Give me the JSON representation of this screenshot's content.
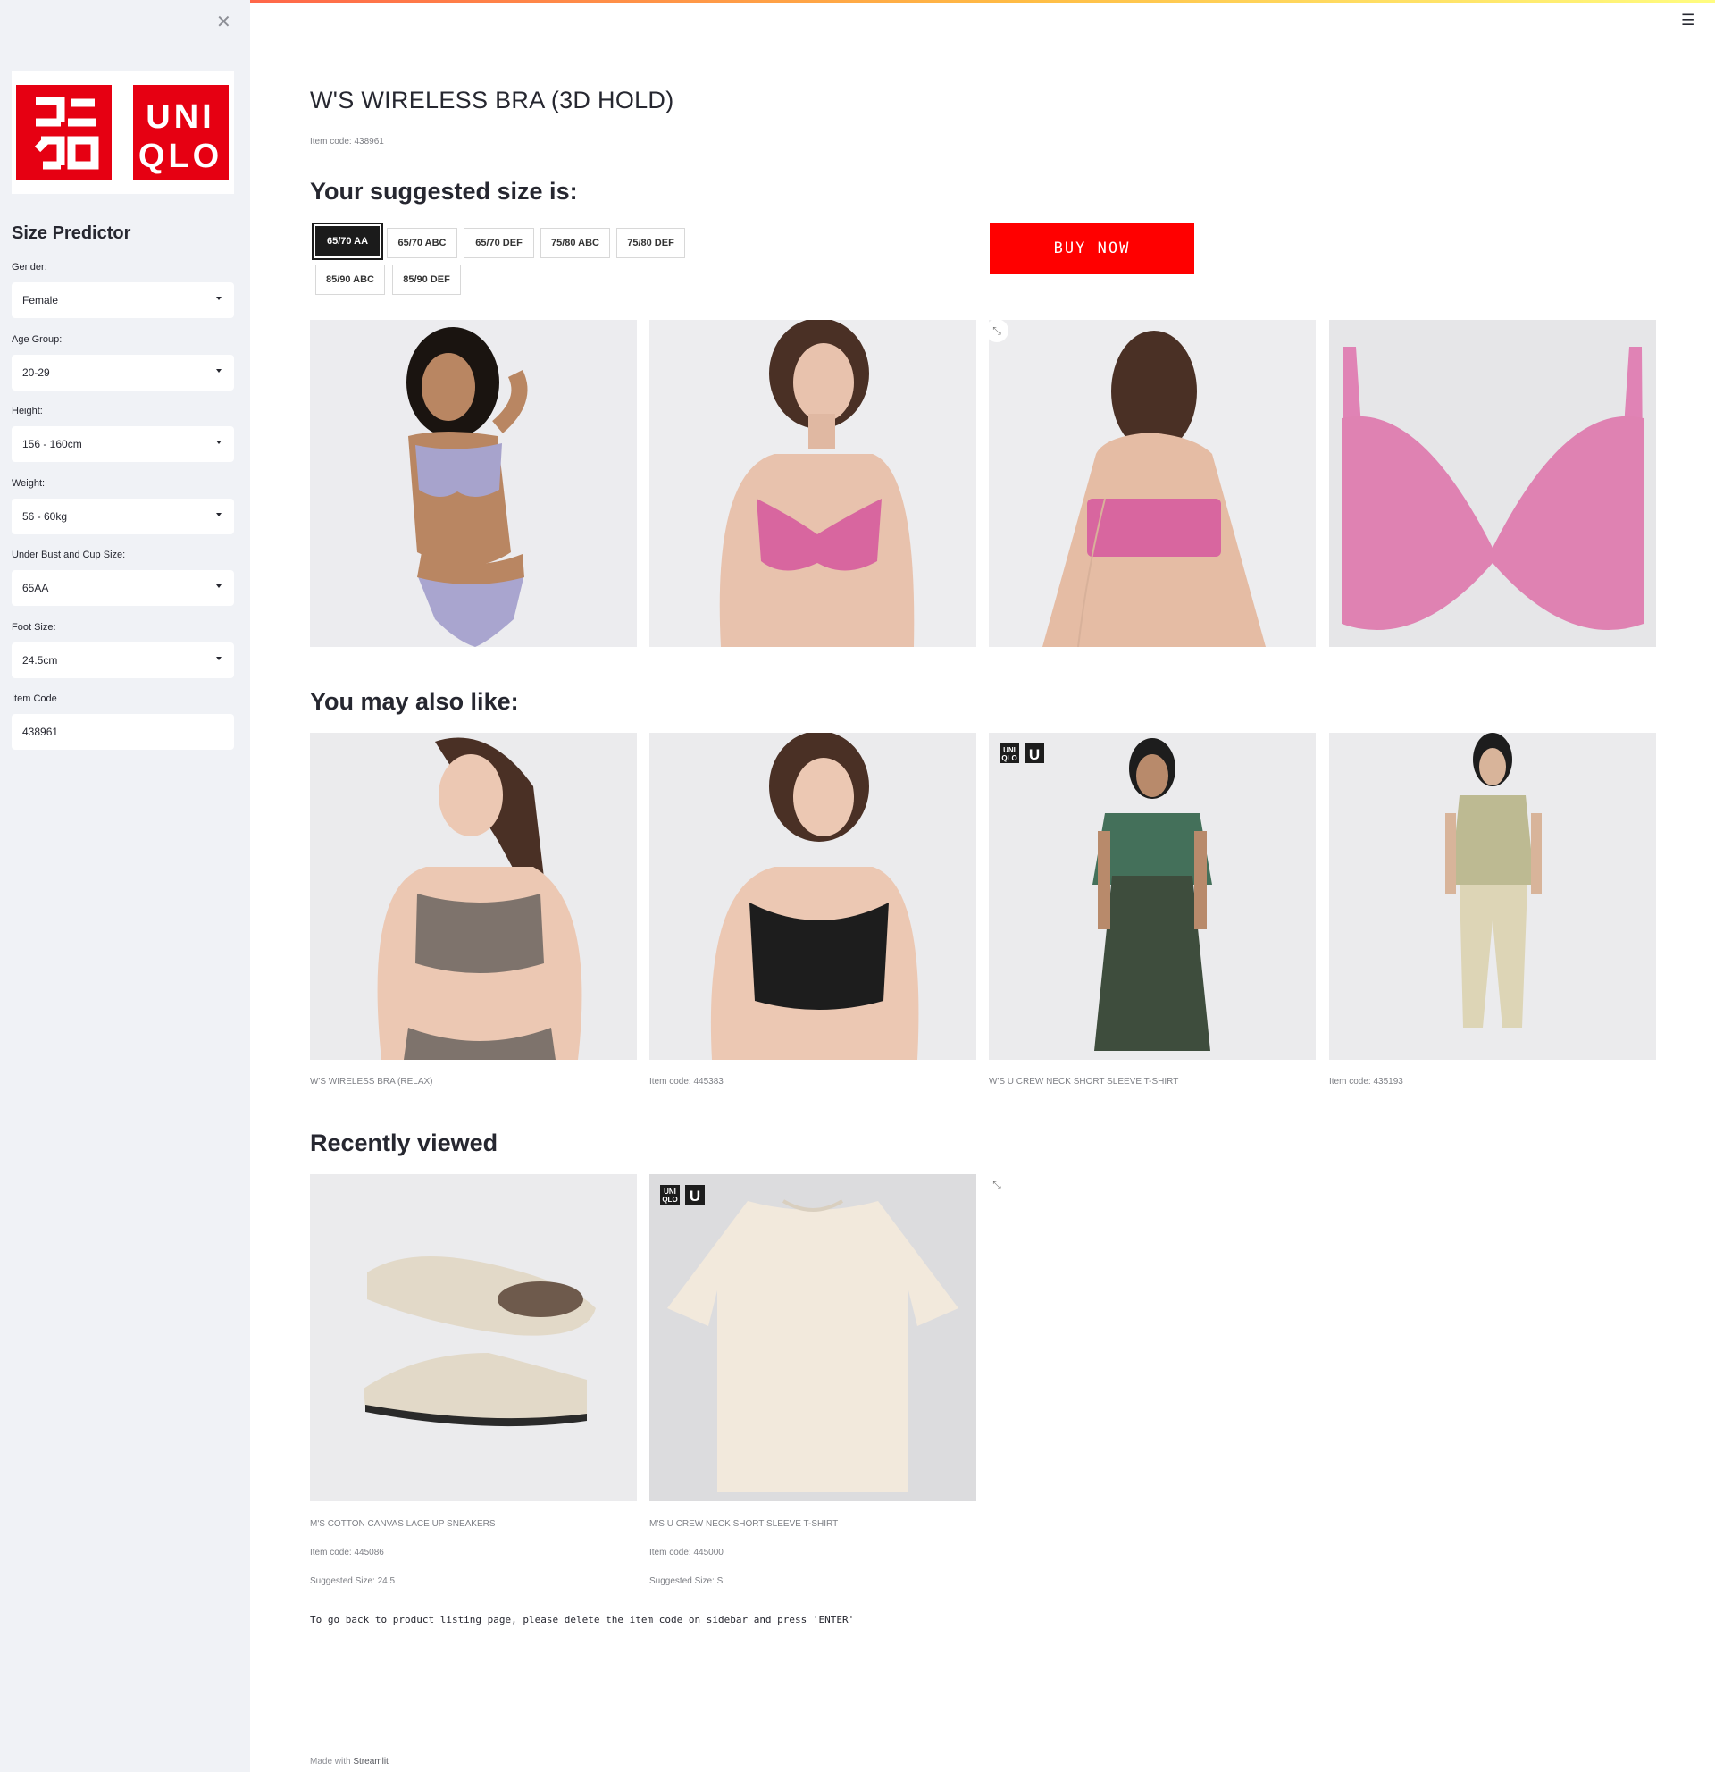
{
  "sidebar": {
    "logo": {
      "left_text": "ユニクロ",
      "right_text": "UNIQLO",
      "color": "#e60012"
    },
    "title": "Size Predictor",
    "fields": [
      {
        "label": "Gender:",
        "value": "Female"
      },
      {
        "label": "Age Group:",
        "value": "20-29"
      },
      {
        "label": "Height:",
        "value": "156 - 160cm"
      },
      {
        "label": "Weight:",
        "value": "56 - 60kg"
      },
      {
        "label": "Under Bust and Cup Size:",
        "value": "65AA"
      },
      {
        "label": "Foot Size:",
        "value": "24.5cm"
      }
    ],
    "item_code": {
      "label": "Item Code",
      "value": "438961"
    }
  },
  "product": {
    "title": "W'S WIRELESS BRA (3D HOLD)",
    "item_code": "Item code: 438961",
    "suggested_heading": "Your suggested size is:",
    "sizes": [
      "65/70 AA",
      "65/70 ABC",
      "65/70 DEF",
      "75/80 ABC",
      "75/80 DEF",
      "85/90 ABC",
      "85/90 DEF"
    ],
    "selected_size": "65/70 AA",
    "buy_label": "BUY NOW",
    "buy_color": "#ff0000"
  },
  "also_like": {
    "heading": "You may also like:",
    "items": [
      {
        "caption": "W'S WIRELESS BRA (RELAX)"
      },
      {
        "caption": "Item code: 445383"
      },
      {
        "caption": "W'S U CREW NECK SHORT SLEEVE T-SHIRT"
      },
      {
        "caption": "Item code: 435193"
      }
    ]
  },
  "recent": {
    "heading": "Recently viewed",
    "items": [
      {
        "name": "M'S COTTON CANVAS LACE UP SNEAKERS",
        "code": "Item code: 445086",
        "size": "Suggested Size: 24.5"
      },
      {
        "name": "M'S U CREW NECK SHORT SLEEVE T-SHIRT",
        "code": "Item code: 445000",
        "size": "Suggested Size: S"
      }
    ]
  },
  "note": "To go back to product listing page, please delete the item code on sidebar and press 'ENTER'",
  "footer": {
    "prefix": "Made with ",
    "brand": "Streamlit"
  },
  "icons": {
    "close": "close-icon",
    "menu": "hamburger-menu-icon",
    "expand": "expand-icon"
  }
}
